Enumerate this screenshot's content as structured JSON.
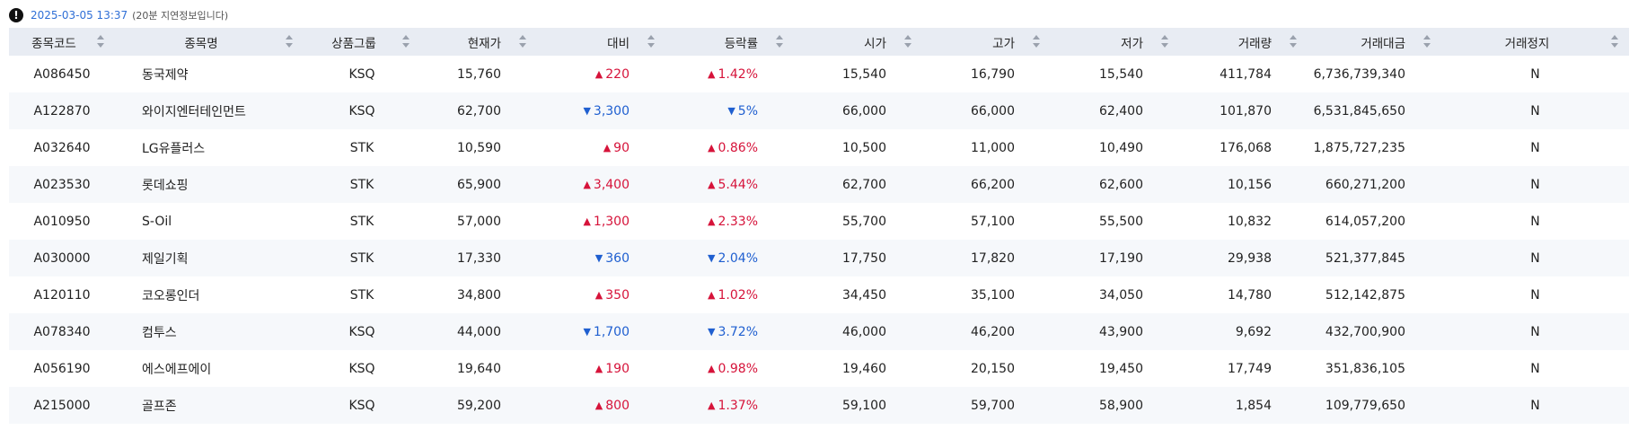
{
  "info": {
    "timestamp": "2025-03-05 13:37",
    "delay_note": "(20분 지연정보입니다)",
    "alert_icon": "!"
  },
  "icons": {
    "alert": "exclamation-circle-icon",
    "sort": "sort-both-icon",
    "up": "triangle-up-icon",
    "down": "triangle-down-icon"
  },
  "colors": {
    "up": "#d6133a",
    "down": "#1f5fd0",
    "header_bg": "#e8ecf3",
    "timestamp": "#2f6fd6"
  },
  "columns": [
    "종목코드",
    "종목명",
    "상품그룹",
    "현재가",
    "대비",
    "등락률",
    "시가",
    "고가",
    "저가",
    "거래량",
    "거래대금",
    "거래정지"
  ],
  "rows": [
    {
      "code": "A086450",
      "name": "동국제약",
      "group": "KSQ",
      "price": "15,760",
      "dir": "up",
      "change": "220",
      "rate": "1.42%",
      "open": "15,540",
      "high": "16,790",
      "low": "15,540",
      "volume": "411,784",
      "amount": "6,736,739,340",
      "halt": "N"
    },
    {
      "code": "A122870",
      "name": "와이지엔터테인먼트",
      "group": "KSQ",
      "price": "62,700",
      "dir": "down",
      "change": "3,300",
      "rate": "5%",
      "open": "66,000",
      "high": "66,000",
      "low": "62,400",
      "volume": "101,870",
      "amount": "6,531,845,650",
      "halt": "N"
    },
    {
      "code": "A032640",
      "name": "LG유플러스",
      "group": "STK",
      "price": "10,590",
      "dir": "up",
      "change": "90",
      "rate": "0.86%",
      "open": "10,500",
      "high": "11,000",
      "low": "10,490",
      "volume": "176,068",
      "amount": "1,875,727,235",
      "halt": "N"
    },
    {
      "code": "A023530",
      "name": "롯데쇼핑",
      "group": "STK",
      "price": "65,900",
      "dir": "up",
      "change": "3,400",
      "rate": "5.44%",
      "open": "62,700",
      "high": "66,200",
      "low": "62,600",
      "volume": "10,156",
      "amount": "660,271,200",
      "halt": "N"
    },
    {
      "code": "A010950",
      "name": "S-Oil",
      "group": "STK",
      "price": "57,000",
      "dir": "up",
      "change": "1,300",
      "rate": "2.33%",
      "open": "55,700",
      "high": "57,100",
      "low": "55,500",
      "volume": "10,832",
      "amount": "614,057,200",
      "halt": "N"
    },
    {
      "code": "A030000",
      "name": "제일기획",
      "group": "STK",
      "price": "17,330",
      "dir": "down",
      "change": "360",
      "rate": "2.04%",
      "open": "17,750",
      "high": "17,820",
      "low": "17,190",
      "volume": "29,938",
      "amount": "521,377,845",
      "halt": "N"
    },
    {
      "code": "A120110",
      "name": "코오롱인더",
      "group": "STK",
      "price": "34,800",
      "dir": "up",
      "change": "350",
      "rate": "1.02%",
      "open": "34,450",
      "high": "35,100",
      "low": "34,050",
      "volume": "14,780",
      "amount": "512,142,875",
      "halt": "N"
    },
    {
      "code": "A078340",
      "name": "컴투스",
      "group": "KSQ",
      "price": "44,000",
      "dir": "down",
      "change": "1,700",
      "rate": "3.72%",
      "open": "46,000",
      "high": "46,200",
      "low": "43,900",
      "volume": "9,692",
      "amount": "432,700,900",
      "halt": "N"
    },
    {
      "code": "A056190",
      "name": "에스에프에이",
      "group": "KSQ",
      "price": "19,640",
      "dir": "up",
      "change": "190",
      "rate": "0.98%",
      "open": "19,460",
      "high": "20,150",
      "low": "19,450",
      "volume": "17,749",
      "amount": "351,836,105",
      "halt": "N"
    },
    {
      "code": "A215000",
      "name": "골프존",
      "group": "KSQ",
      "price": "59,200",
      "dir": "up",
      "change": "800",
      "rate": "1.37%",
      "open": "59,100",
      "high": "59,700",
      "low": "58,900",
      "volume": "1,854",
      "amount": "109,779,650",
      "halt": "N"
    }
  ]
}
